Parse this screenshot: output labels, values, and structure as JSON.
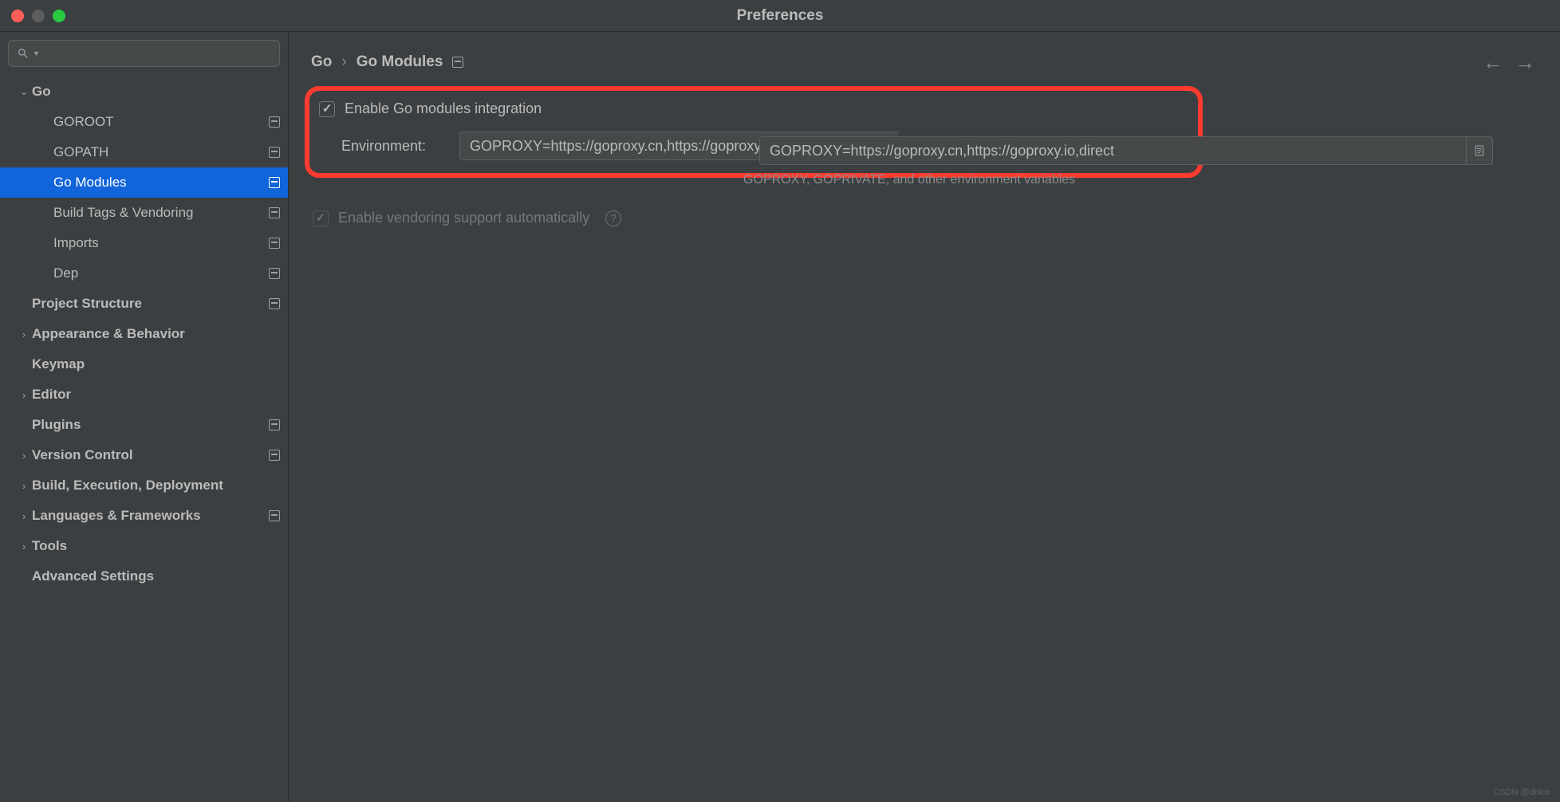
{
  "window": {
    "title": "Preferences"
  },
  "search": {
    "placeholder": ""
  },
  "sidebar": {
    "go": {
      "label": "Go",
      "children": [
        {
          "label": "GOROOT",
          "proj": true
        },
        {
          "label": "GOPATH",
          "proj": true
        },
        {
          "label": "Go Modules",
          "proj": true,
          "selected": true
        },
        {
          "label": "Build Tags & Vendoring",
          "proj": true
        },
        {
          "label": "Imports",
          "proj": true
        },
        {
          "label": "Dep",
          "proj": true
        }
      ]
    },
    "items": [
      {
        "label": "Project Structure",
        "proj": true,
        "chev": false
      },
      {
        "label": "Appearance & Behavior",
        "chev": true
      },
      {
        "label": "Keymap",
        "chev": false
      },
      {
        "label": "Editor",
        "chev": true
      },
      {
        "label": "Plugins",
        "proj": true,
        "chev": false
      },
      {
        "label": "Version Control",
        "proj": true,
        "chev": true
      },
      {
        "label": "Build, Execution, Deployment",
        "chev": true
      },
      {
        "label": "Languages & Frameworks",
        "proj": true,
        "chev": true
      },
      {
        "label": "Tools",
        "chev": true
      },
      {
        "label": "Advanced Settings",
        "chev": false
      }
    ]
  },
  "breadcrumb": {
    "root": "Go",
    "leaf": "Go Modules"
  },
  "settings": {
    "enable_label": "Enable Go modules integration",
    "env_label": "Environment:",
    "env_value": "GOPROXY=https://goproxy.cn,https://goproxy.io,direct",
    "env_hint": "GOPROXY, GOPRIVATE, and other environment variables",
    "vendor_label": "Enable vendoring support automatically"
  },
  "watermark": "CSDN @dnice"
}
